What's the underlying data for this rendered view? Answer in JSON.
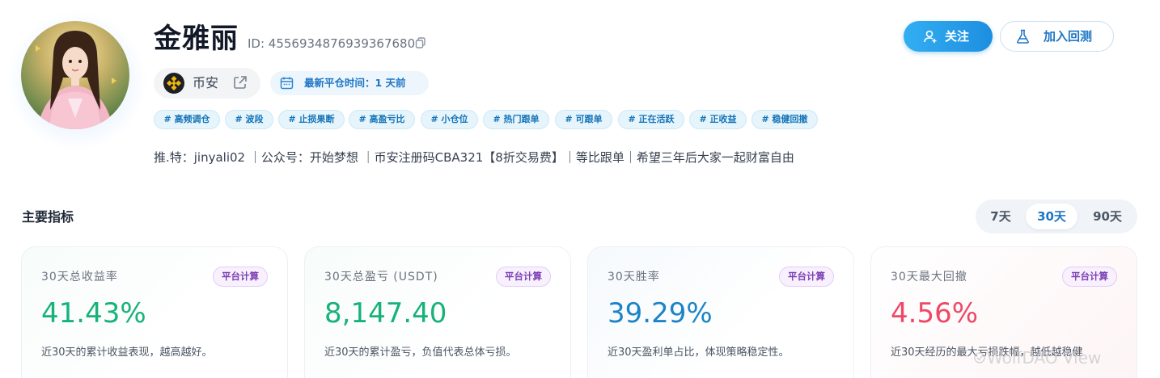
{
  "profile": {
    "name": "金雅丽",
    "id_text": "ID: 4556934876939367680",
    "exchange": "币安",
    "last_close": "最新平仓时间：1 天前",
    "tags": [
      "# 高频调仓",
      "# 波段",
      "# 止损果断",
      "# 高盈亏比",
      "# 小仓位",
      "# 热门跟单",
      "# 可跟单",
      "# 正在活跃",
      "# 正收益",
      "# 稳健回撤"
    ],
    "bio": "推.特：jinyali02 ｜公众号：开始梦想 ｜币安注册码CBA321【8折交易费】｜等比跟单｜希望三年后大家一起财富自由"
  },
  "actions": {
    "follow_label": "关注",
    "backtest_label": "加入回测"
  },
  "metrics": {
    "title": "主要指标",
    "ranges": [
      "7天",
      "30天",
      "90天"
    ],
    "active_range": "30天",
    "cards": [
      {
        "label": "30天总收益率",
        "badge": "平台计算",
        "value": "41.43%",
        "value_color": "#16b27a",
        "desc": "近30天的累计收益表现，越高越好。"
      },
      {
        "label": "30天总盈亏 (USDT)",
        "badge": "平台计算",
        "value": "8,147.40",
        "value_color": "#16b27a",
        "desc": "近30天的累计盈亏，负值代表总体亏损。"
      },
      {
        "label": "30天胜率",
        "badge": "平台计算",
        "value": "39.29%",
        "value_color": "#1b84c6",
        "desc": "近30天盈利单占比，体现策略稳定性。"
      },
      {
        "label": "30天最大回撤",
        "badge": "平台计算",
        "value": "4.56%",
        "value_color": "#ee4866",
        "desc": "近30天经历的最大亏损跌幅，越低越稳健"
      }
    ]
  },
  "watermark": "WolfDAO View"
}
